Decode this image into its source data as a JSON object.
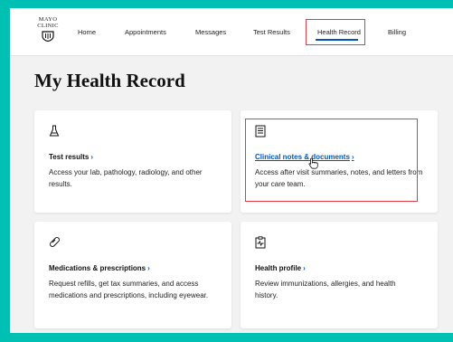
{
  "logo": {
    "line1": "MAYO",
    "line2": "CLINIC"
  },
  "nav": {
    "items": [
      "Home",
      "Appointments",
      "Messages",
      "Test Results",
      "Health Record",
      "Billing"
    ],
    "active": "Health Record"
  },
  "page": {
    "title": "My Health Record"
  },
  "cards": [
    {
      "title": "Test results",
      "description": "Access your lab, pathology, radiology, and other results.",
      "icon": "flask-icon"
    },
    {
      "title": "Clinical notes & documents",
      "description": "Access after visit summaries, notes, and letters from your care team.",
      "icon": "document-icon"
    },
    {
      "title": "Medications & prescriptions",
      "description": "Request refills, get tax summaries, and access medications and prescriptions, including eyewear.",
      "icon": "pill-icon"
    },
    {
      "title": "Health profile",
      "description": "Review immunizations, allergies, and health history.",
      "icon": "health-profile-icon"
    }
  ],
  "colors": {
    "accent": "#0057b8",
    "highlight": "#e63946",
    "frame": "#00c0b4"
  }
}
